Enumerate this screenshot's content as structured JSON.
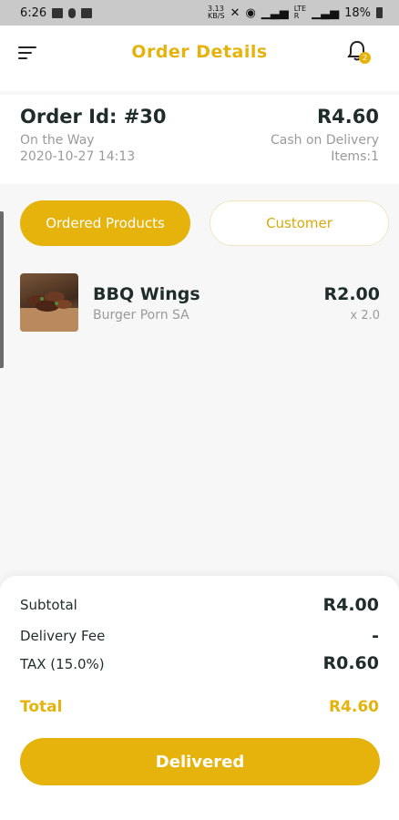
{
  "status_bar": {
    "time": "6:26",
    "signal_text": "3.13\nKB/S",
    "network_text": "LTE\nR",
    "battery": "18%"
  },
  "header": {
    "title": "Order Details",
    "notification_count": "2"
  },
  "order": {
    "id_label": "Order Id: #30",
    "status": "On the Way",
    "datetime": "2020-10-27 14:13",
    "total": "R4.60",
    "payment": "Cash on Delivery",
    "items": "Items:1"
  },
  "tabs": [
    {
      "label": "Ordered Products",
      "active": true
    },
    {
      "label": "Customer",
      "active": false
    }
  ],
  "products": [
    {
      "name": "BBQ Wings",
      "store": "Burger Porn SA",
      "price": "R2.00",
      "quantity": "x 2.0"
    }
  ],
  "summary": {
    "subtotal_label": "Subtotal",
    "subtotal_value": "R4.00",
    "delivery_label": "Delivery Fee",
    "delivery_value": "-",
    "tax_label": "TAX (15.0%)",
    "tax_value": "R0.60",
    "total_label": "Total",
    "total_value": "R4.60"
  },
  "actions": {
    "delivered_label": "Delivered"
  },
  "colors": {
    "accent": "#e5b30c",
    "text_dark": "#1f2d2a",
    "text_muted": "#9a9a9a"
  }
}
